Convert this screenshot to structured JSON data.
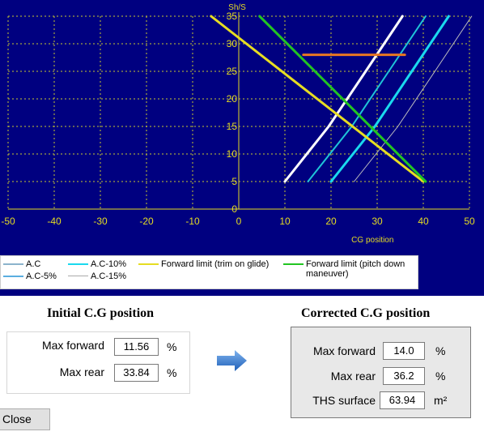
{
  "chart_data": {
    "type": "line",
    "ylabel": "Sh/S",
    "xlabel": "CG position",
    "xlim": [
      -50,
      50
    ],
    "ylim": [
      0,
      35
    ],
    "x_ticks": [
      "-50",
      "-40",
      "-30",
      "-20",
      "-10",
      "0",
      "10",
      "20",
      "30",
      "40",
      "50"
    ],
    "y_ticks": [
      "0",
      "5",
      "10",
      "15",
      "20",
      "25",
      "30",
      "35"
    ],
    "grid": true,
    "series": [
      {
        "name": "A.C",
        "color": "#ffffff",
        "points": [
          [
            10,
            5
          ],
          [
            19.5,
            15
          ],
          [
            27.5,
            25
          ],
          [
            35.5,
            35
          ]
        ]
      },
      {
        "name": "A.C-5%",
        "color": "#1fc4d8",
        "points": [
          [
            15,
            5
          ],
          [
            24.5,
            15
          ],
          [
            32.5,
            25
          ],
          [
            40.5,
            35
          ]
        ]
      },
      {
        "name": "A.C-10%",
        "color": "#1ad9ee",
        "points": [
          [
            20,
            5
          ],
          [
            29.5,
            15
          ],
          [
            37.5,
            25
          ],
          [
            45.5,
            35
          ]
        ]
      },
      {
        "name": "A.C-15%",
        "color": "#c0c0c0",
        "points": [
          [
            25,
            5
          ],
          [
            34.5,
            15
          ],
          [
            42.5,
            25
          ],
          [
            50.5,
            35
          ]
        ]
      },
      {
        "name": "Forward limit (trim on glide)",
        "color": "#e6dd22",
        "points": [
          [
            -6,
            35
          ],
          [
            40,
            5
          ]
        ]
      },
      {
        "name": "Forward limit (pitch down maneuver)",
        "color": "#22c522",
        "points": [
          [
            4.5,
            35
          ],
          [
            40.5,
            5
          ]
        ]
      },
      {
        "name": "",
        "color": "#e87722",
        "points": [
          [
            14,
            28
          ],
          [
            36,
            28
          ]
        ]
      }
    ]
  },
  "initial": {
    "title": "Initial C.G position",
    "max_forward_label": "Max forward",
    "max_forward_value": "11.56",
    "max_rear_label": "Max rear",
    "max_rear_value": "33.84",
    "unit": "%"
  },
  "corrected": {
    "title": "Corrected C.G position",
    "max_forward_label": "Max forward",
    "max_forward_value": "14.0",
    "max_rear_label": "Max rear",
    "max_rear_value": "36.2",
    "ths_label": "THS surface",
    "ths_value": "63.94",
    "unit_percent": "%",
    "unit_area": "m²"
  },
  "arrow_color": "#2f7fd6",
  "close_label": "Close"
}
